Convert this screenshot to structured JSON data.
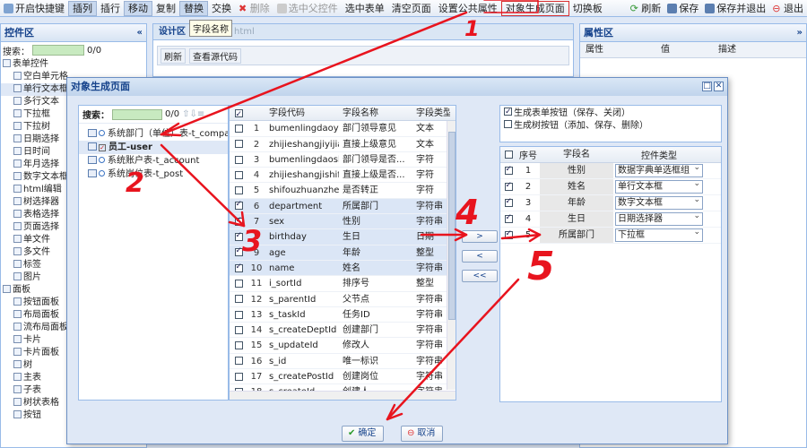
{
  "toolbar": {
    "items": [
      "开启快捷键",
      "插列",
      "插行",
      "移动",
      "复制",
      "替换",
      "交换",
      "删除",
      "选中父控件",
      "选中表单",
      "清空页面",
      "设置公共属性",
      "对象生成页面",
      "切换板"
    ],
    "right": [
      "刷新",
      "保存",
      "保存并退出",
      "退出"
    ]
  },
  "left_panel": {
    "title": "控件区",
    "search_label": "搜索：",
    "search_count": "0/0",
    "items": [
      "表单控件",
      "空白单元格",
      "单行文本框",
      "多行文本",
      "下拉框",
      "下拉树",
      "日期选择",
      "日时间",
      "年月选择",
      "数字文本框",
      "html编辑",
      "树选择器",
      "表格选择",
      "页面选择",
      "单文件",
      "多文件",
      "标签",
      "图片",
      "面板",
      "按钮面板",
      "布局面板",
      "流布局面板",
      "卡片",
      "卡片面板",
      "树",
      "主表",
      "子表",
      "树状表格",
      "按钮"
    ]
  },
  "center": {
    "tabs": [
      "设计区",
      "html"
    ],
    "tooltip": "字段名称",
    "refresh": "刷新",
    "view_source": "查看源代码"
  },
  "right_panel": {
    "title": "属性区",
    "cols": [
      "属性",
      "值",
      "描述"
    ]
  },
  "dialog": {
    "title": "对象生成页面",
    "search_label": "搜索：",
    "search_count": "0/0",
    "tree": [
      "系统部门（单位）表-t_company",
      "员工-user",
      "系统账户表-t_account",
      "系统岗位表-t_post"
    ],
    "grid_headers": [
      "",
      "字段代码",
      "字段名称",
      "字段类型"
    ],
    "grid_rows": [
      {
        "no": "1",
        "code": "bumenlingdaoyijian",
        "name": "部门领导意见",
        "type": "文本",
        "checked": false
      },
      {
        "no": "2",
        "code": "zhijieshangjiyijian",
        "name": "直接上级意见",
        "type": "文本",
        "checked": false
      },
      {
        "no": "3",
        "code": "bumenlingdaoshifou",
        "name": "部门领导是否...",
        "type": "字符",
        "checked": false
      },
      {
        "no": "4",
        "code": "zhijieshangjishifou",
        "name": "直接上级是否...",
        "type": "字符",
        "checked": false
      },
      {
        "no": "5",
        "code": "shifouzhuanzheng",
        "name": "是否转正",
        "type": "字符",
        "checked": false
      },
      {
        "no": "6",
        "code": "department",
        "name": "所属部门",
        "type": "字符串",
        "checked": true
      },
      {
        "no": "7",
        "code": "sex",
        "name": "性别",
        "type": "字符串",
        "checked": true
      },
      {
        "no": "8",
        "code": "birthday",
        "name": "生日",
        "type": "日期",
        "checked": true
      },
      {
        "no": "9",
        "code": "age",
        "name": "年龄",
        "type": "整型",
        "checked": true
      },
      {
        "no": "10",
        "code": "name",
        "name": "姓名",
        "type": "字符串",
        "checked": true
      },
      {
        "no": "11",
        "code": "i_sortId",
        "name": "排序号",
        "type": "整型",
        "checked": false
      },
      {
        "no": "12",
        "code": "s_parentId",
        "name": "父节点",
        "type": "字符串",
        "checked": false
      },
      {
        "no": "13",
        "code": "s_taskId",
        "name": "任务ID",
        "type": "字符串",
        "checked": false
      },
      {
        "no": "14",
        "code": "s_createDeptId",
        "name": "创建部门",
        "type": "字符串",
        "checked": false
      },
      {
        "no": "15",
        "code": "s_updateId",
        "name": "修改人",
        "type": "字符串",
        "checked": false
      },
      {
        "no": "16",
        "code": "s_id",
        "name": "唯一标识",
        "type": "字符串",
        "checked": false
      },
      {
        "no": "17",
        "code": "s_createPostId",
        "name": "创建岗位",
        "type": "字符串",
        "checked": false
      },
      {
        "no": "18",
        "code": "s_createId",
        "name": "创建人",
        "type": "字符串",
        "checked": false
      }
    ],
    "move_buttons": [
      ">",
      "<",
      "<<"
    ],
    "options": [
      "生成表单按钮（保存、关闭）",
      "生成树按钮（添加、保存、删除）"
    ],
    "options_checked": [
      true,
      false
    ],
    "sel_headers": [
      "",
      "序号",
      "字段名",
      "控件类型"
    ],
    "sel_rows": [
      {
        "no": "1",
        "field": "性别",
        "control": "数据字典单选框组"
      },
      {
        "no": "2",
        "field": "姓名",
        "control": "单行文本框"
      },
      {
        "no": "3",
        "field": "年龄",
        "control": "数字文本框"
      },
      {
        "no": "4",
        "field": "生日",
        "control": "日期选择器"
      },
      {
        "no": "5",
        "field": "所属部门",
        "control": "下拉框"
      }
    ],
    "ok": "确定",
    "cancel": "取消"
  },
  "annotations": [
    "1",
    "2",
    "3",
    "4",
    "5"
  ],
  "colors": {
    "annotation": "#e8141e",
    "accent": "#15428b"
  }
}
